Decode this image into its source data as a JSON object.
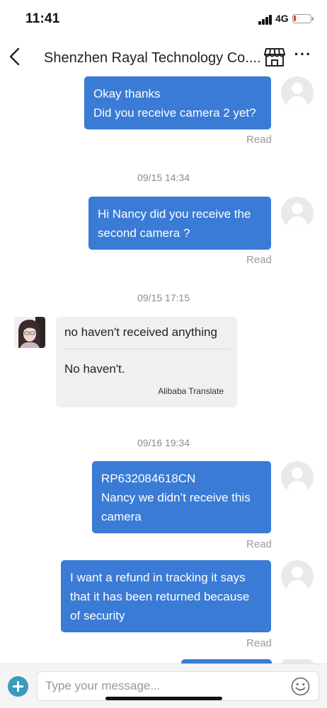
{
  "status_bar": {
    "time": "11:41",
    "network": "4G",
    "battery_color": "#e0403a"
  },
  "header": {
    "title": "Shenzhen Rayal Technology Co...."
  },
  "messages": {
    "m1": {
      "lines": [
        "Okay thanks",
        "Did you receive camera 2 yet?"
      ],
      "status": "Read"
    },
    "ts1": "09/15 14:34",
    "m2": {
      "lines": [
        "Hi Nancy did you receive the",
        "second camera ?"
      ],
      "status": "Read"
    },
    "ts2": "09/15 17:15",
    "m3": {
      "original": "no haven't received anything",
      "translation": "No haven't.",
      "translator": "Alibaba Translate"
    },
    "ts3": "09/16 19:34",
    "m4": {
      "lines": [
        "RP632084618CN",
        "Nancy we didn’t receive this",
        "camera"
      ],
      "status": "Read"
    },
    "m5": {
      "lines": [
        "I want a refund in tracking it says",
        "that it has been returned because",
        "of security"
      ],
      "status": "Read"
    }
  },
  "composer": {
    "placeholder": "Type your message..."
  },
  "colors": {
    "outgoing_bubble": "#3a7bd5",
    "incoming_bubble": "#f0f0f0",
    "add_button": "#3a9bbd"
  },
  "icons": [
    "back-chevron-icon",
    "store-icon",
    "more-icon",
    "default-avatar-icon",
    "plus-icon",
    "emoji-icon"
  ]
}
